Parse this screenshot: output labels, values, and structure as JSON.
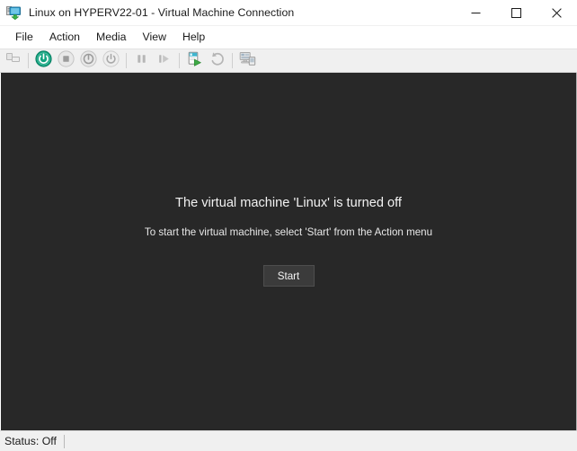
{
  "window": {
    "title": "Linux on HYPERV22-01 - Virtual Machine Connection",
    "icon": "virtual-machine-monitor-icon",
    "controls": {
      "minimize_label": "Minimize",
      "maximize_label": "Maximize",
      "close_label": "Close"
    }
  },
  "menubar": {
    "items": [
      {
        "label": "File"
      },
      {
        "label": "Action"
      },
      {
        "label": "Media"
      },
      {
        "label": "View"
      },
      {
        "label": "Help"
      }
    ]
  },
  "toolbar": {
    "buttons": [
      {
        "name": "ctrl-alt-delete-icon",
        "label": "Ctrl+Alt+Delete",
        "enabled": false
      },
      {
        "name": "separator",
        "label": "",
        "enabled": false
      },
      {
        "name": "start-power-icon",
        "label": "Start",
        "enabled": true
      },
      {
        "name": "turn-off-icon",
        "label": "Turn Off",
        "enabled": false
      },
      {
        "name": "shut-down-icon",
        "label": "Shut Down",
        "enabled": false
      },
      {
        "name": "save-state-icon",
        "label": "Save",
        "enabled": false
      },
      {
        "name": "separator",
        "label": "",
        "enabled": false
      },
      {
        "name": "pause-icon",
        "label": "Pause",
        "enabled": false
      },
      {
        "name": "resume-icon",
        "label": "Resume",
        "enabled": false
      },
      {
        "name": "separator",
        "label": "",
        "enabled": false
      },
      {
        "name": "checkpoint-icon",
        "label": "Checkpoint",
        "enabled": true
      },
      {
        "name": "revert-icon",
        "label": "Revert",
        "enabled": false
      },
      {
        "name": "separator",
        "label": "",
        "enabled": false
      },
      {
        "name": "enhanced-session-icon",
        "label": "Enhanced Session",
        "enabled": false
      }
    ]
  },
  "vm_screen": {
    "message_title": "The virtual machine 'Linux' is turned off",
    "message_subtitle": "To start the virtual machine, select 'Start' from the Action menu",
    "start_button_label": "Start",
    "background_color": "#282828"
  },
  "statusbar": {
    "status_text": "Status: Off"
  },
  "colors": {
    "accent_green": "#11a37f",
    "titlebar_bg": "#ffffff",
    "toolbar_bg": "#f0f0f0",
    "vm_bg": "#282828",
    "statusbar_bg": "#f0f0f0"
  }
}
